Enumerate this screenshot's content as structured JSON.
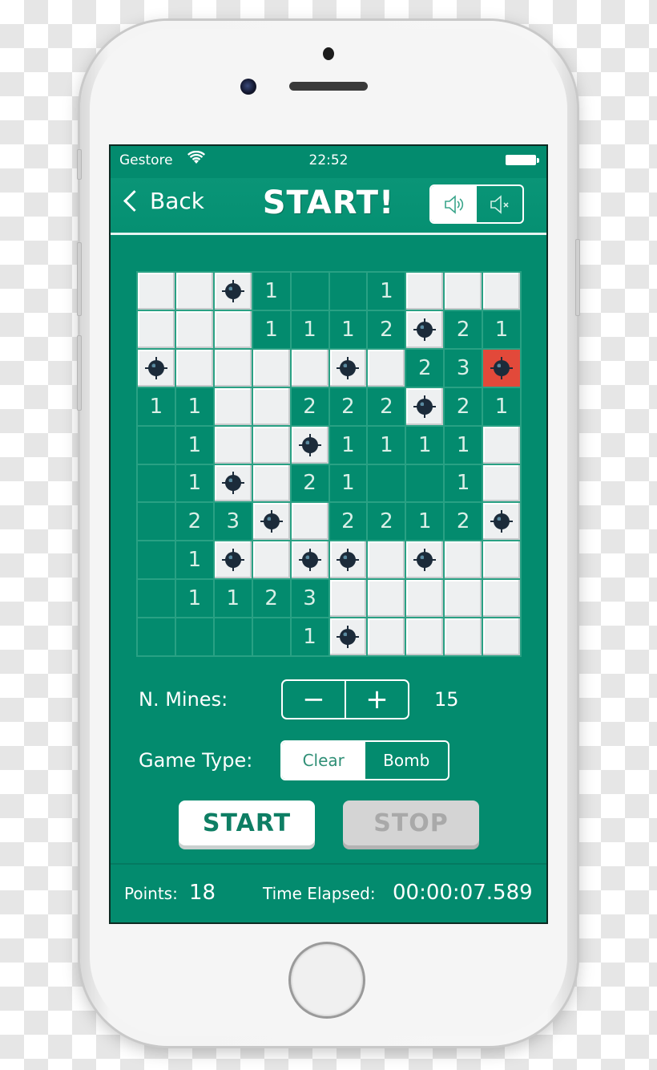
{
  "status_bar": {
    "carrier": "Gestore",
    "wifi_icon": "wifi-icon",
    "time": "22:52",
    "battery_icon": "battery-icon"
  },
  "nav": {
    "back_label": "Back",
    "title": "START!",
    "sound_toggle": {
      "options": [
        "sound-on-icon",
        "sound-off-icon"
      ],
      "selected": "sound-on"
    }
  },
  "board": {
    "rows": 10,
    "cols": 10,
    "legend": {
      "C": "covered",
      "M": "mine",
      "X": "exploded-mine",
      "0": "open-empty",
      "1-8": "open-number"
    },
    "cells": [
      [
        "C",
        "C",
        "M",
        "1",
        "0",
        "0",
        "1",
        "C",
        "C",
        "C"
      ],
      [
        "C",
        "C",
        "C",
        "1",
        "1",
        "1",
        "2",
        "M",
        "2",
        "1"
      ],
      [
        "M",
        "C",
        "C",
        "C",
        "C",
        "M",
        "C",
        "2",
        "3",
        "X"
      ],
      [
        "1",
        "1",
        "C",
        "C",
        "2",
        "2",
        "2",
        "M",
        "2",
        "1"
      ],
      [
        "0",
        "1",
        "C",
        "C",
        "M",
        "1",
        "1",
        "1",
        "1",
        "C"
      ],
      [
        "0",
        "1",
        "M",
        "C",
        "2",
        "1",
        "0",
        "0",
        "1",
        "C"
      ],
      [
        "0",
        "2",
        "3",
        "M",
        "C",
        "2",
        "2",
        "1",
        "2",
        "M"
      ],
      [
        "0",
        "1",
        "M",
        "C",
        "M",
        "M",
        "C",
        "M",
        "C",
        "C"
      ],
      [
        "0",
        "1",
        "1",
        "2",
        "3",
        "C",
        "C",
        "C",
        "C",
        "C"
      ],
      [
        "0",
        "0",
        "0",
        "0",
        "1",
        "M",
        "C",
        "C",
        "C",
        "C"
      ]
    ]
  },
  "controls": {
    "mines_label": "N. Mines:",
    "minus_label": "−",
    "plus_label": "+",
    "mines_count": "15",
    "game_type_label": "Game Type:",
    "game_types": [
      "Clear",
      "Bomb"
    ],
    "game_type_selected": "Clear",
    "start_label": "START",
    "stop_label": "STOP"
  },
  "footer": {
    "points_label": "Points:",
    "points_value": "18",
    "time_label": "Time Elapsed:",
    "time_value": "00:00:07.589"
  },
  "colors": {
    "screen_bg": "#038b6e",
    "covered_cell": "#eef0f1",
    "exploded_cell": "#e2493a",
    "mine": "#1c2b3a"
  }
}
